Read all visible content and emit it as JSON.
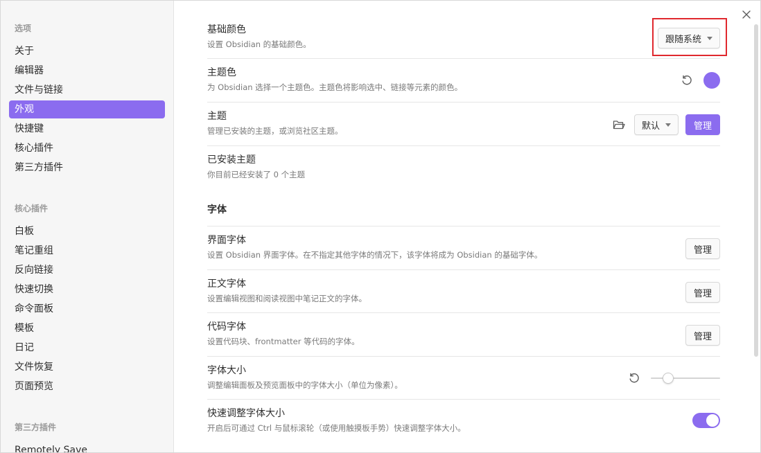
{
  "sidebar": {
    "groups": [
      {
        "title": "选项",
        "items": [
          "关于",
          "编辑器",
          "文件与链接",
          "外观",
          "快捷键",
          "核心插件",
          "第三方插件"
        ]
      },
      {
        "title": "核心插件",
        "items": [
          "白板",
          "笔记重组",
          "反向链接",
          "快速切换",
          "命令面板",
          "模板",
          "日记",
          "文件恢复",
          "页面预览"
        ]
      },
      {
        "title": "第三方插件",
        "items": [
          "Remotely Save"
        ]
      }
    ],
    "active_item": "外观"
  },
  "settings": {
    "base_color": {
      "name": "基础颜色",
      "desc": "设置 Obsidian 的基础颜色。",
      "dropdown_value": "跟随系统"
    },
    "accent_color": {
      "name": "主题色",
      "desc": "为 Obsidian 选择一个主题色。主题色将影响选中、链接等元素的颜色。",
      "color": "#8b6cef"
    },
    "theme": {
      "name": "主题",
      "desc": "管理已安装的主题，或浏览社区主题。",
      "dropdown_value": "默认",
      "manage_label": "管理"
    },
    "installed_themes": {
      "name": "已安装主题",
      "desc": "你目前已经安装了 0 个主题"
    },
    "font_section": {
      "heading": "字体"
    },
    "interface_font": {
      "name": "界面字体",
      "desc": "设置 Obsidian 界面字体。在不指定其他字体的情况下，该字体将成为 Obsidian 的基础字体。",
      "manage_label": "管理"
    },
    "text_font": {
      "name": "正文字体",
      "desc": "设置编辑视图和阅读视图中笔记正文的字体。",
      "manage_label": "管理"
    },
    "monospace_font": {
      "name": "代码字体",
      "desc": "设置代码块、frontmatter 等代码的字体。",
      "manage_label": "管理"
    },
    "font_size": {
      "name": "字体大小",
      "desc": "调整编辑面板及预览面板中的字体大小（单位为像素）。",
      "slider_fraction": 0.2
    },
    "quick_font_size": {
      "name": "快速调整字体大小",
      "desc": "开启后可通过 Ctrl 与鼠标滚轮（或使用触摸板手势）快速调整字体大小。",
      "enabled": true
    }
  },
  "colors": {
    "accent": "#8b6cef",
    "highlight": "#e0282e"
  },
  "icons": {
    "close": "close-icon",
    "reset": "reset-icon",
    "folder": "folder-icon"
  }
}
